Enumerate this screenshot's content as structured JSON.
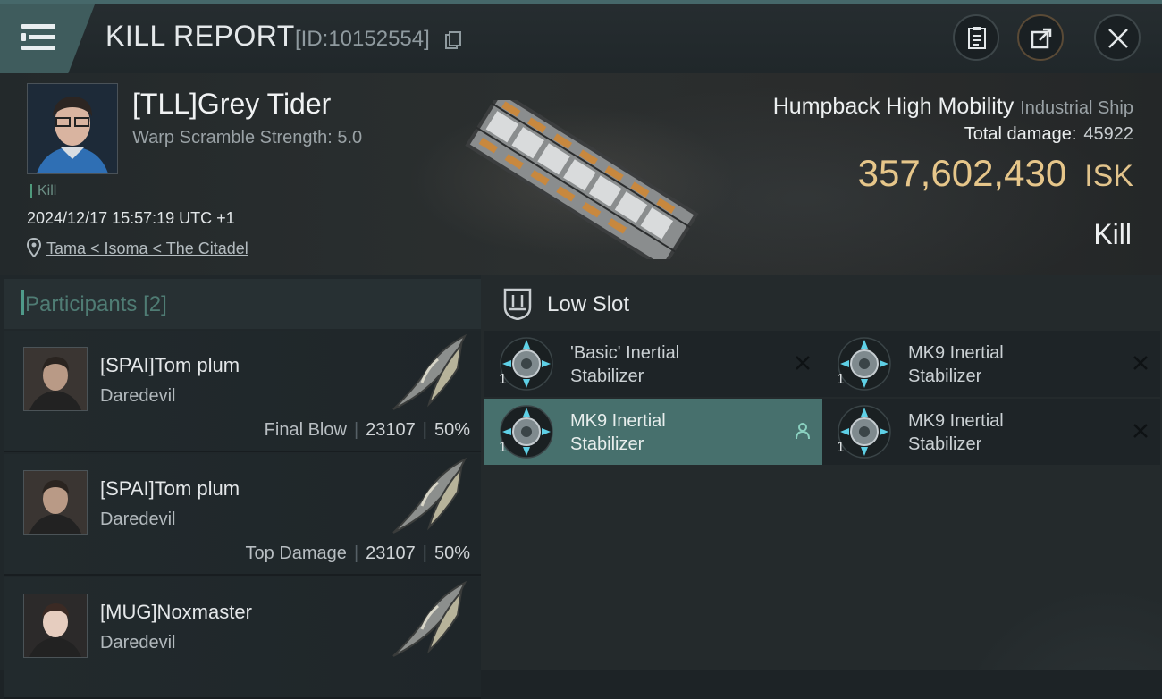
{
  "header": {
    "title": "KILL REPORT",
    "kill_id": "[ID:10152554]"
  },
  "victim": {
    "name": "[TLL]Grey Tider",
    "warp_scramble": "Warp Scramble Strength: 5.0",
    "tag": "Kill",
    "timestamp": "2024/12/17 15:57:19 UTC +1",
    "location": "Tama < Isoma < The Citadel",
    "ship_name": "Humpback High Mobility",
    "ship_class": "Industrial Ship",
    "total_damage_label": "Total damage:",
    "total_damage_value": "45922",
    "isk_value": "357,602,430",
    "isk_unit": "ISK",
    "result": "Kill"
  },
  "participants": {
    "title": "Participants",
    "count": "[2]",
    "rows": [
      {
        "name": "[SPAI]Tom plum",
        "ship": "Daredevil",
        "label": "Final Blow",
        "damage": "23107",
        "percent": "50%"
      },
      {
        "name": "[SPAI]Tom plum",
        "ship": "Daredevil",
        "label": "Top Damage",
        "damage": "23107",
        "percent": "50%"
      },
      {
        "name": "[MUG]Noxmaster",
        "ship": "Daredevil",
        "label": "",
        "damage": "",
        "percent": ""
      }
    ]
  },
  "low_slot": {
    "title": "Low Slot",
    "items": [
      {
        "line1": "'Basic' Inertial",
        "line2": "Stabilizer",
        "qty": "1",
        "state": "destroyed"
      },
      {
        "line1": "MK9 Inertial",
        "line2": "Stabilizer",
        "qty": "1",
        "state": "destroyed"
      },
      {
        "line1": "MK9 Inertial",
        "line2": "Stabilizer",
        "qty": "1",
        "state": "dropped"
      },
      {
        "line1": "MK9 Inertial",
        "line2": "Stabilizer",
        "qty": "1",
        "state": "destroyed"
      }
    ]
  },
  "colors": {
    "accent": "#47706d",
    "isk": "#e6c68a",
    "menu_tab": "#3f5c5d"
  },
  "icons": [
    "menu-icon",
    "copy-icon",
    "clipboard-icon",
    "share-icon",
    "close-icon",
    "location-pin-icon",
    "low-slot-icon",
    "module-icon",
    "destroyed-x-icon",
    "person-icon"
  ]
}
